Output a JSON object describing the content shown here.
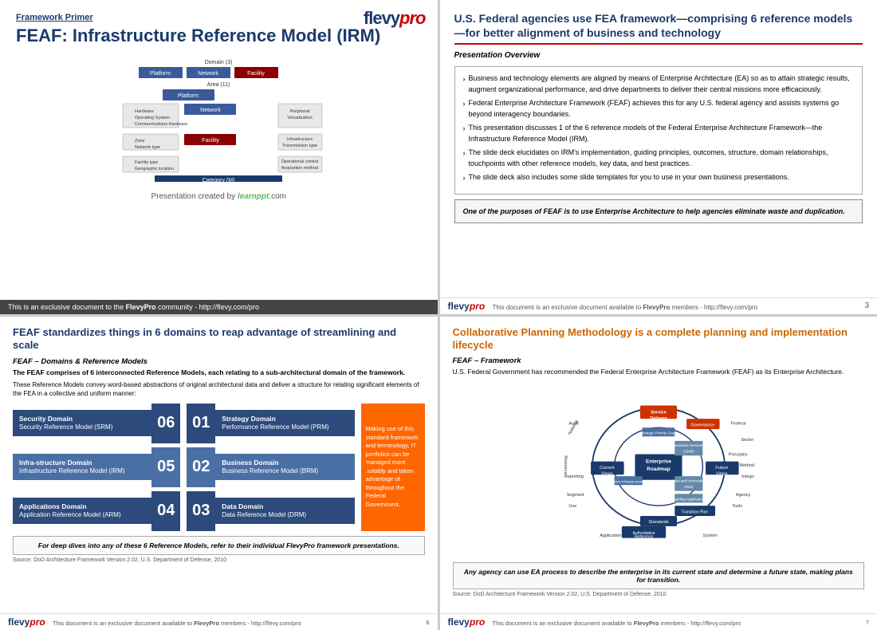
{
  "slide1": {
    "logo_flevy": "flevy",
    "logo_pro": "pro",
    "framework_primer": "Framework Primer",
    "main_title": "FEAF: Infrastructure Reference Model (IRM)",
    "created_by_prefix": "Presentation created by ",
    "created_by_brand": "learnppt",
    "created_by_suffix": ".com",
    "footer_text": "This is an exclusive document to the ",
    "footer_bold": "FlevyPro",
    "footer_suffix": " community - http://flevy.com/pro"
  },
  "slide2": {
    "title": "U.S. Federal agencies use FEA framework—comprising 6 reference models—for better alignment of business and technology",
    "section_label": "Presentation Overview",
    "bullet1_bold": "Business and technology elements are aligned by means of Enterprise Architecture (EA) so as to attain strategic results, augment organizational performance, and drive departments to deliver their central missions more efficaciously.",
    "bullet2_bold": "Federal Enterprise Architecture Framework (FEAF) achieves this for any U.S. federal agency and assists systems go beyond interagency boundaries.",
    "bullet3": "This presentation discusses 1 of the 6 reference models of the Federal Enterprise Architecture Framework—the Infrastructure Reference Model (IRM).",
    "bullet4": "The slide deck elucidates on IRM's implementation, guiding principles, outcomes, structure, domain relationships, touchpoints with other reference models, key data, and best practices.",
    "bullet5": "The slide deck also includes some slide templates for you to use in your own business presentations.",
    "italic_quote": "One of the purposes of FEAF is to use Enterprise Architecture to help agencies eliminate waste and duplication.",
    "footer_text": "This document is an exclusive document available to ",
    "footer_bold": "FlevyPro",
    "footer_suffix": " members - http://flevy.com/pro",
    "page_num": "3"
  },
  "slide3": {
    "title": "FEAF standardizes things in 6 domains to reap advantage of streamlining and scale",
    "section_label": "FEAF – Domains & Reference Models",
    "body_bold": "The FEAF comprises of 6 interconnected Reference Models, each relating to a sub-architectural domain of the framework.",
    "body_text": "These Reference Models convey word-based abstractions of original architectural data and deliver a structure for relating significant elements of the FEA in a collective and uniform manner:",
    "domains": [
      {
        "title": "Security Domain",
        "subtitle": "Security Reference Model (SRM)",
        "num": "06"
      },
      {
        "title": "Infra-structure Domain",
        "subtitle": "Infrastructure Reference Model (IRM)",
        "num": "05"
      },
      {
        "title": "Applications Domain",
        "subtitle": "Application Reference Model (ARM)",
        "num": "04"
      }
    ],
    "domains_right": [
      {
        "title": "Strategy Domain",
        "subtitle": "Performance Reference Model (PRM)",
        "num": "01"
      },
      {
        "title": "Business Domain",
        "subtitle": "Business Reference Model (BRM)",
        "num": "02"
      },
      {
        "title": "Data Domain",
        "subtitle": "Data Reference Model (DRM)",
        "num": "03"
      }
    ],
    "callout": "Making use of this standard framework and terminology, IT portfolios can be managed more suitably and taken advantage of throughout the Federal Government.",
    "bottom_italic": "For deep dives into any of these 6 Reference Models, refer to their individual FlevyPro framework presentations.",
    "source": "Source: DoD Architecture Framework Version 2.02, U.S. Department of Defense, 2010",
    "footer_text": "This document is an exclusive document available to ",
    "footer_bold": "FlevyPro",
    "footer_suffix": " members - http://flevy.com/pro",
    "page_num": "6"
  },
  "slide4": {
    "title": "Collaborative Planning Methodology is a complete planning and implementation lifecycle",
    "section_label": "FEAF – Framework",
    "body_text": "U.S. Federal Government has recommended the Federal Enterprise Architecture Framework (FEAF) as its Enterprise Architecture.",
    "bottom_italic": "Any agency can use EA process to describe the enterprise in its current state and determine a future state, making plans for transition.",
    "source": "Source: DoD Architecture Framework Version 2.02, U.S. Department of Defense, 2010",
    "footer_text": "This document is an exclusive document available to ",
    "footer_bold": "FlevyPro",
    "footer_suffix": " members - http://flevy.com/pro",
    "page_num": "7"
  }
}
